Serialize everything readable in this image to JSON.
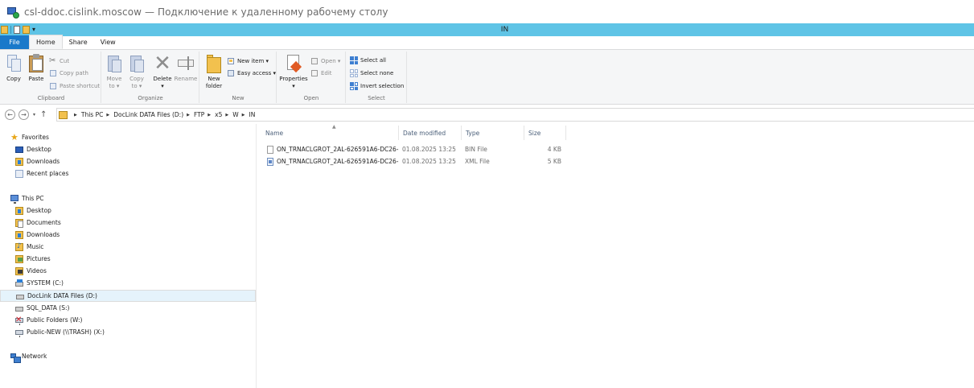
{
  "rdp": {
    "title": "csl-ddoc.cislink.moscow — Подключение к удаленному рабочему столу"
  },
  "window": {
    "title": "IN",
    "qa_dropdown": "▾"
  },
  "ribbon": {
    "tabs": [
      "File",
      "Home",
      "Share",
      "View"
    ],
    "clipboard": {
      "label": "Clipboard",
      "copy": "Copy",
      "paste": "Paste",
      "cut": "Cut",
      "copy_path": "Copy path",
      "paste_shortcut": "Paste shortcut"
    },
    "organize": {
      "label": "Organize",
      "move_to_line1": "Move",
      "move_to_line2": "to ▾",
      "copy_to_line1": "Copy",
      "copy_to_line2": "to ▾",
      "delete_line1": "Delete",
      "delete_line2": "▾",
      "rename": "Rename"
    },
    "new": {
      "label": "New",
      "new_folder_line1": "New",
      "new_folder_line2": "folder",
      "new_item": "New item ▾",
      "easy_access": "Easy access ▾"
    },
    "open": {
      "label": "Open",
      "properties_line1": "Properties",
      "properties_line2": "▾",
      "open": "Open ▾",
      "edit": "Edit"
    },
    "select": {
      "label": "Select",
      "select_all": "Select all",
      "select_none": "Select none",
      "invert_selection": "Invert selection"
    }
  },
  "nav_buttons": {
    "back": "←",
    "forward": "→",
    "recent": "▾",
    "up": "↑"
  },
  "address": {
    "crumbs": [
      "This PC",
      "DocLink DATA Files (D:)",
      "FTP",
      "x5",
      "W",
      "IN"
    ]
  },
  "nav": {
    "favorites": {
      "label": "Favorites",
      "items": [
        "Desktop",
        "Downloads",
        "Recent places"
      ]
    },
    "this_pc": {
      "label": "This PC",
      "items": [
        "Desktop",
        "Documents",
        "Downloads",
        "Music",
        "Pictures",
        "Videos",
        "SYSTEM (C:)",
        "DocLink DATA Files (D:)",
        "SQL_DATA (S:)",
        "Public Folders (W:)",
        "Public-NEW (\\\\TRASH) (X:)"
      ]
    },
    "network": {
      "label": "Network"
    }
  },
  "files": {
    "columns": {
      "name": "Name",
      "date": "Date modified",
      "type": "Type",
      "size": "Size"
    },
    "rows": [
      {
        "name": "ON_TRNACLGROT_2AL-626591A6-DC26-...",
        "date": "01.08.2025 13:25",
        "type": "BIN File",
        "size": "4 KB"
      },
      {
        "name": "ON_TRNACLGROT_2AL-626591A6-DC26-...",
        "date": "01.08.2025 13:25",
        "type": "XML File",
        "size": "5 KB"
      }
    ]
  }
}
